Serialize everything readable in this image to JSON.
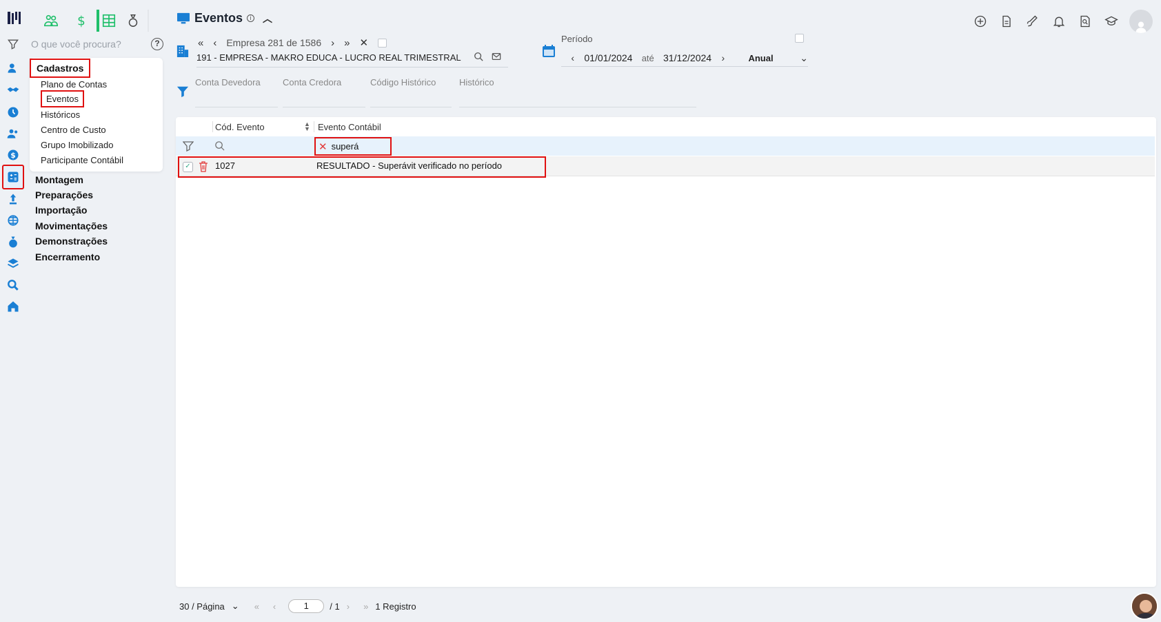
{
  "search": {
    "placeholder": "O que você procura?"
  },
  "menu": {
    "title": "Cadastros",
    "items": [
      "Plano de Contas",
      "Eventos",
      "Históricos",
      "Centro de Custo",
      "Grupo Imobilizado",
      "Participante Contábil"
    ],
    "groups": [
      "Montagem",
      "Preparações",
      "Importação",
      "Movimentações",
      "Demonstrações",
      "Encerramento"
    ]
  },
  "header": {
    "title": "Eventos"
  },
  "empresa": {
    "nav_label": "Empresa 281 de 1586",
    "name": "191 - EMPRESA - MAKRO EDUCA - LUCRO REAL TRIMESTRAL"
  },
  "periodo": {
    "label": "Período",
    "start": "01/01/2024",
    "ate": "até",
    "end": "31/12/2024",
    "type": "Anual"
  },
  "filters": [
    "Conta Devedora",
    "Conta Credora",
    "Código Histórico",
    "Histórico"
  ],
  "grid": {
    "columns": [
      "Cód. Evento",
      "Evento Contábil"
    ],
    "filter_value": "superá",
    "rows": [
      {
        "codigo": "1027",
        "evento": "RESULTADO - Superávit verificado no período"
      }
    ]
  },
  "footer": {
    "page_size": "30 / Página",
    "page": "1",
    "total_pages": "/ 1",
    "records": "1 Registro"
  },
  "colors": {
    "accent": "#1a7fd4",
    "highlight": "#e01010",
    "green": "#1fbf6a"
  }
}
